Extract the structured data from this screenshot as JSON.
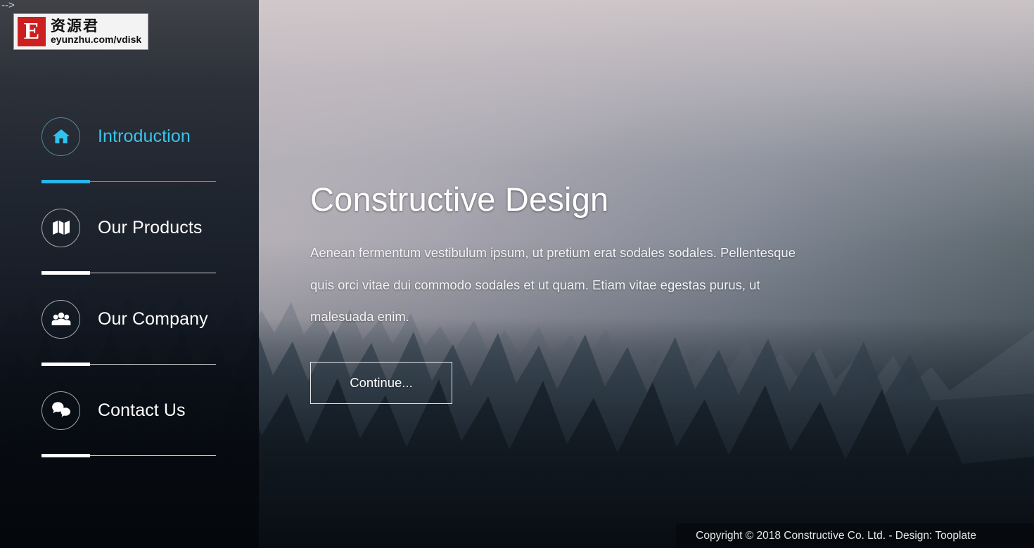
{
  "artifact": {
    "text": "-->"
  },
  "watermark": {
    "letter": "E",
    "cn_text": "资源君",
    "url": "eyunzhu.com/vdisk"
  },
  "sidebar": {
    "items": [
      {
        "label": "Introduction",
        "icon": "home-icon",
        "active": true,
        "bar_fill_pct": 28
      },
      {
        "label": "Our Products",
        "icon": "map-icon",
        "active": false,
        "bar_fill_pct": 28
      },
      {
        "label": "Our Company",
        "icon": "people-icon",
        "active": false,
        "bar_fill_pct": 28
      },
      {
        "label": "Contact Us",
        "icon": "comments-icon",
        "active": false,
        "bar_fill_pct": 28
      }
    ]
  },
  "hero": {
    "title": "Constructive Design",
    "body": "Aenean fermentum vestibulum ipsum, ut pretium erat sodales sodales. Pellentesque quis orci vitae dui commodo sodales et ut quam. Etiam vitae egestas purus, ut malesuada enim.",
    "button_label": "Continue..."
  },
  "footer": {
    "copyright": "Copyright © 2018 Constructive Co. Ltd. - Design: Tooplate"
  },
  "colors": {
    "accent": "#2ab4e8",
    "accent_text": "#3cc3ec",
    "text_light": "#ffffff",
    "sidebar_overlay": "#11181f"
  }
}
